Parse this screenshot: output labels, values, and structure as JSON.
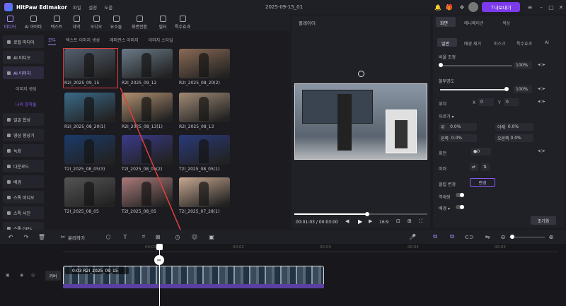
{
  "app": {
    "name": "HitPaw Edimakor",
    "menu": [
      "파일",
      "설정",
      "도움"
    ],
    "project": "2025-09-15_01",
    "upgrade": "내보내기"
  },
  "toolbar": [
    {
      "label": "미디어",
      "icon": "media-icon",
      "active": true
    },
    {
      "label": "AI 아바타",
      "icon": "avatar-icon"
    },
    {
      "label": "텍스트",
      "icon": "text-icon"
    },
    {
      "label": "자막",
      "icon": "subtitle-icon"
    },
    {
      "label": "오디오",
      "icon": "audio-icon"
    },
    {
      "label": "요소들",
      "icon": "elements-icon"
    },
    {
      "label": "화면전환",
      "icon": "transition-icon"
    },
    {
      "label": "필터",
      "icon": "filter-icon"
    },
    {
      "label": "특수효과",
      "icon": "effects-icon"
    }
  ],
  "sidebar": [
    {
      "label": "로컬 미디어"
    },
    {
      "label": "AI 비디오"
    },
    {
      "label": "AI 이미지",
      "active": true
    },
    {
      "label": "이미지 생성",
      "sub": true
    },
    {
      "label": "나의 창작물",
      "sub": true,
      "active": true
    },
    {
      "label": "얼굴 합성"
    },
    {
      "label": "영상 향상기"
    },
    {
      "label": "녹화"
    },
    {
      "label": "다운로드"
    },
    {
      "label": "배경"
    },
    {
      "label": "스톡 비디오"
    },
    {
      "label": "스톡 사진"
    },
    {
      "label": "스톡 GIFs"
    }
  ],
  "filters": [
    "모두",
    "텍스트 이미지 생성",
    "레퍼런스 이미지",
    "이미지 스타일"
  ],
  "thumbs": [
    {
      "label": "R2I_2025_09_15",
      "color": "#556070"
    },
    {
      "label": "R2I_2025_09_12",
      "color": "#6a7a88"
    },
    {
      "label": "R2I_2025_08_20(2)",
      "color": "#8a6a55"
    },
    {
      "label": "R2I_2025_08_20(1)",
      "color": "#3a6a88"
    },
    {
      "label": "R2I_2025_08_13(1)",
      "color": "#b09070"
    },
    {
      "label": "R2I_2025_08_13",
      "color": "#a08a75"
    },
    {
      "label": "T2I_2025_08_05(3)",
      "color": "#1a3a6a"
    },
    {
      "label": "T2I_2025_08_05(2)",
      "color": "#3a3a8a"
    },
    {
      "label": "T2I_2025_08_05(1)",
      "color": "#2a3a7a"
    },
    {
      "label": "T2I_2025_08_05",
      "color": "#555555"
    },
    {
      "label": "T2I_2025_08_05",
      "color": "#aa7a7a"
    },
    {
      "label": "T2I_2025_07_28(1)",
      "color": "#c8a890"
    }
  ],
  "player": {
    "title": "플레이어",
    "time": "00:01:03",
    "duration": "00:03:00",
    "ratio": "16:9",
    "progress": 0.55
  },
  "right": {
    "tabs": [
      "화면",
      "애니메이션",
      "색상"
    ],
    "subtabs": [
      "일반",
      "배경 제거",
      "마스크",
      "특수효과",
      "AI"
    ],
    "scale_label": "비율 조정",
    "scale_val": "100%",
    "opacity_label": "불투명도",
    "opacity_val": "100%",
    "pos_label": "위치",
    "x_label": "X",
    "x_val": "0",
    "y_label": "Y",
    "y_val": "0",
    "crop_label": "자르기",
    "crop": [
      {
        "l": "위",
        "v": "0.0%"
      },
      {
        "l": "아래",
        "v": "0.0%"
      },
      {
        "l": "왼쪽",
        "v": "0.0%"
      },
      {
        "l": "오른쪽",
        "v": "0.0%"
      }
    ],
    "rotate_label": "회전",
    "rotate_val": "0",
    "mirror_label": "미러",
    "clip_label": "클립 변경",
    "clip_btn": "변경",
    "reverse_label": "역재생",
    "bg_label": "배경",
    "reset": "초기화"
  },
  "timeline": {
    "split": "분리하기",
    "ticks": [
      "00:01",
      "00:02",
      "00:03",
      "00:04",
      "00:05"
    ],
    "track": "커버",
    "clip_label": "0:03 R2I_2025_09_15"
  }
}
